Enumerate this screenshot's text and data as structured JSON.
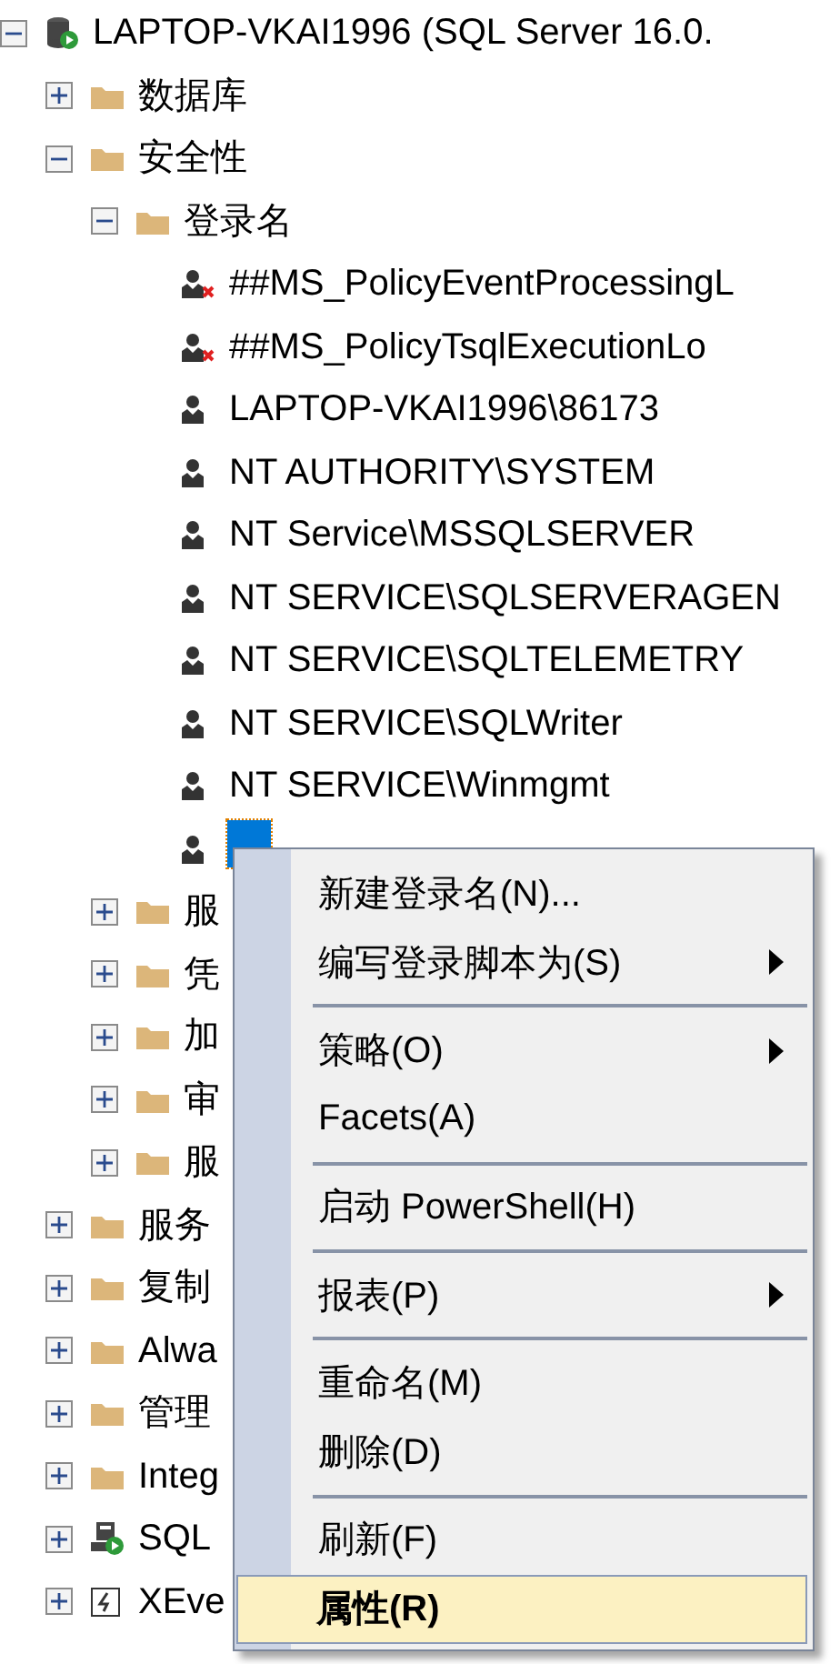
{
  "tree": [
    {
      "label": "LAPTOP-VKAI1996 (SQL Server 16.0.",
      "kind": "server",
      "expanded": true,
      "children": [
        {
          "label": "数据库",
          "kind": "folder",
          "expanded": false
        },
        {
          "label": "安全性",
          "kind": "folder",
          "expanded": true,
          "children": [
            {
              "label": "登录名",
              "kind": "folder",
              "expanded": true,
              "children": [
                {
                  "label": "##MS_PolicyEventProcessingL",
                  "kind": "login",
                  "disabled": true,
                  "selected": false
                },
                {
                  "label": "##MS_PolicyTsqlExecutionLo",
                  "kind": "login",
                  "disabled": true,
                  "selected": false
                },
                {
                  "label": "LAPTOP-VKAI1996\\86173",
                  "kind": "login",
                  "disabled": false,
                  "selected": false
                },
                {
                  "label": "NT AUTHORITY\\SYSTEM",
                  "kind": "login",
                  "disabled": false,
                  "selected": false
                },
                {
                  "label": "NT Service\\MSSQLSERVER",
                  "kind": "login",
                  "disabled": false,
                  "selected": false
                },
                {
                  "label": "NT SERVICE\\SQLSERVERAGEN",
                  "kind": "login",
                  "disabled": false,
                  "selected": false
                },
                {
                  "label": "NT SERVICE\\SQLTELEMETRY",
                  "kind": "login",
                  "disabled": false,
                  "selected": false
                },
                {
                  "label": "NT SERVICE\\SQLWriter",
                  "kind": "login",
                  "disabled": false,
                  "selected": false
                },
                {
                  "label": "NT SERVICE\\Winmgmt",
                  "kind": "login",
                  "disabled": false,
                  "selected": false
                },
                {
                  "kind": "login",
                  "disabled": false,
                  "selected": true
                }
              ]
            },
            {
              "label": "服",
              "kind": "folder",
              "expanded": false
            },
            {
              "label": "凭",
              "kind": "folder",
              "expanded": false
            },
            {
              "label": "加",
              "kind": "folder",
              "expanded": false
            },
            {
              "label": "审",
              "kind": "folder",
              "expanded": false
            },
            {
              "label": "服",
              "kind": "folder",
              "expanded": false
            }
          ]
        },
        {
          "label": "服务",
          "kind": "folder",
          "expanded": false
        },
        {
          "label": "复制",
          "kind": "folder",
          "expanded": false
        },
        {
          "label": "Alwa",
          "kind": "folder",
          "expanded": false
        },
        {
          "label": "管理",
          "kind": "folder",
          "expanded": false
        },
        {
          "label": "Integ",
          "kind": "folder",
          "expanded": false
        },
        {
          "label": "SQL",
          "kind": "agent",
          "expanded": false
        },
        {
          "label": "XEve",
          "kind": "xevent",
          "expanded": false
        }
      ]
    }
  ],
  "context_menu": [
    {
      "kind": "item",
      "label": "新建登录名(N)...",
      "submenu": false,
      "selected": false
    },
    {
      "kind": "item",
      "label": "编写登录脚本为(S)",
      "submenu": true,
      "selected": false
    },
    {
      "kind": "separator"
    },
    {
      "kind": "item",
      "label": "策略(O)",
      "submenu": true,
      "selected": false
    },
    {
      "kind": "item",
      "label": "Facets(A)",
      "submenu": false,
      "selected": false
    },
    {
      "kind": "separator"
    },
    {
      "kind": "item",
      "label": "启动 PowerShell(H)",
      "submenu": false,
      "selected": false
    },
    {
      "kind": "separator"
    },
    {
      "kind": "item",
      "label": "报表(P)",
      "submenu": true,
      "selected": false
    },
    {
      "kind": "separator"
    },
    {
      "kind": "item",
      "label": "重命名(M)",
      "submenu": false,
      "selected": false
    },
    {
      "kind": "item",
      "label": "删除(D)",
      "submenu": false,
      "selected": false
    },
    {
      "kind": "separator"
    },
    {
      "kind": "item",
      "label": "刷新(F)",
      "submenu": false,
      "selected": false
    },
    {
      "kind": "item",
      "label": "属性(R)",
      "submenu": false,
      "selected": true
    }
  ]
}
